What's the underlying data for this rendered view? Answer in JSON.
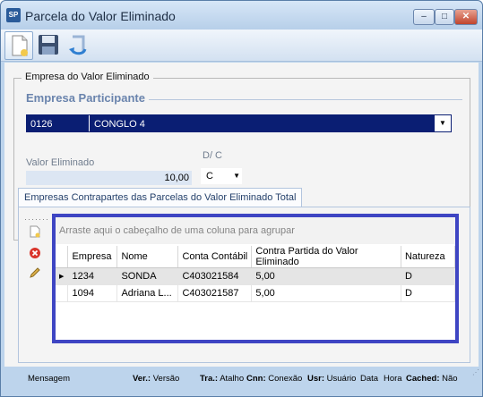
{
  "window": {
    "app_icon": "SP",
    "title": "Parcela do Valor Eliminado",
    "minimize_glyph": "‒",
    "maximize_glyph": "□",
    "close_glyph": "✕"
  },
  "toolbar": {
    "buttons": [
      {
        "name": "new-document-icon"
      },
      {
        "name": "save-icon"
      },
      {
        "name": "undo-icon"
      }
    ]
  },
  "form": {
    "group_title": "Empresa do Valor Eliminado",
    "sub_title": "Empresa Participante",
    "empresa_code": "0126",
    "empresa_name": "CONGLO 4",
    "valor_label": "Valor Eliminado",
    "valor_value": "10,00",
    "dc_label": "D/ C",
    "dc_value": "C"
  },
  "tab": {
    "label": "Empresas Contrapartes das Parcelas do Valor Eliminado Total"
  },
  "grid": {
    "group_hint": "Arraste aqui o cabeçalho de uma coluna para agrupar",
    "columns": [
      "Empresa",
      "Nome",
      "Conta Contábil",
      "Contra Partida do Valor Eliminado",
      "Natureza"
    ],
    "rows": [
      {
        "empresa": "1234",
        "nome": "SONDA",
        "conta": "C403021584",
        "contra": "5,00",
        "natureza": "D"
      },
      {
        "empresa": "1094",
        "nome": "Adriana L...",
        "conta": "C403021587",
        "contra": "5,00",
        "natureza": "D"
      }
    ]
  },
  "status": {
    "mensagem": "Mensagem",
    "ver_label": "Ver.:",
    "ver_value": "Versão",
    "tra_label": "Tra.:",
    "tra_value": "Atalho",
    "cnn_label": "Cnn:",
    "cnn_value": "Conexão",
    "usr_label": "Usr:",
    "usr_value": "Usuário",
    "data_value": "Data",
    "hora_value": "Hora",
    "cached_label": "Cached:",
    "cached_value": "Não"
  },
  "colors": {
    "selection": "#0a1e73",
    "grid_border": "#3e45c3",
    "frame": "#bdd4ec"
  }
}
